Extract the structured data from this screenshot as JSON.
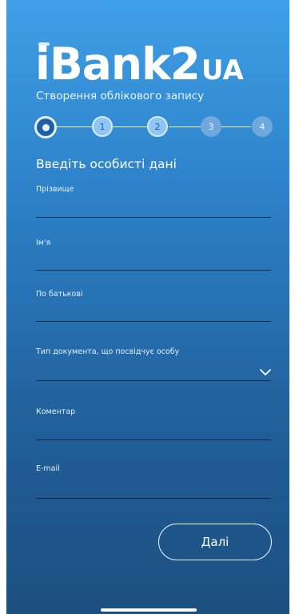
{
  "brand": {
    "logo_main": "iBank2",
    "logo_suffix": "UA"
  },
  "header": {
    "subtitle": "Створення облікового запису"
  },
  "stepper": {
    "steps": [
      "",
      "1",
      "2",
      "3",
      "4"
    ],
    "current_step": 0
  },
  "form": {
    "title": "Введіть особисті дані",
    "fields": [
      {
        "label": "Прізвище",
        "value": ""
      },
      {
        "label": "Ім'я",
        "value": ""
      },
      {
        "label": "По батькові",
        "value": ""
      },
      {
        "label": "Тип документа, що посвідчує особу",
        "value": ""
      },
      {
        "label": "Коментар",
        "value": ""
      },
      {
        "label": "E-mail",
        "value": ""
      }
    ],
    "next_label": "Далі"
  },
  "icons": {
    "chevron": "chevron-down-icon"
  }
}
